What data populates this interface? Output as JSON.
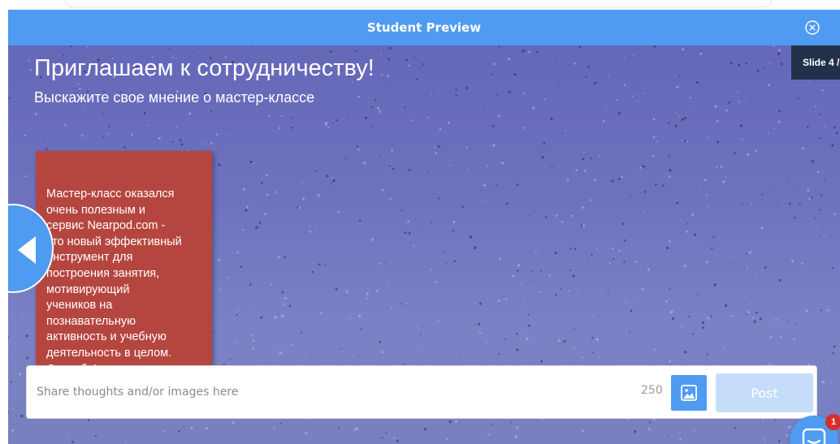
{
  "modal": {
    "title": "Student Preview",
    "close_icon": "close-circle-icon",
    "accent_color": "#4f9bf2"
  },
  "slide": {
    "title": "Приглашаем к сотрудничеству!",
    "subtitle": "Выскажите свое мнение о мастер-классе",
    "counter": "Slide 4 /",
    "note_lines": [
      "Мастер-класс оказался",
      "очень полезным и",
      "сервис Nearpod.com -",
      "это новый эффективный",
      "инструмент для",
      "построения занятия,",
      "мотивирующий",
      "учеников на",
      "познавательную",
      "активность и учебную",
      "деятельность в целом.",
      "Спасибо!"
    ],
    "note_color": "#b5463f",
    "prev_icon": "chevron-left-icon"
  },
  "comment": {
    "placeholder": "Share thoughts and/or images here",
    "char_limit": "250",
    "image_icon": "image-icon",
    "post_label": "Post"
  },
  "chat": {
    "icon": "chat-icon",
    "badge_count": "1"
  }
}
